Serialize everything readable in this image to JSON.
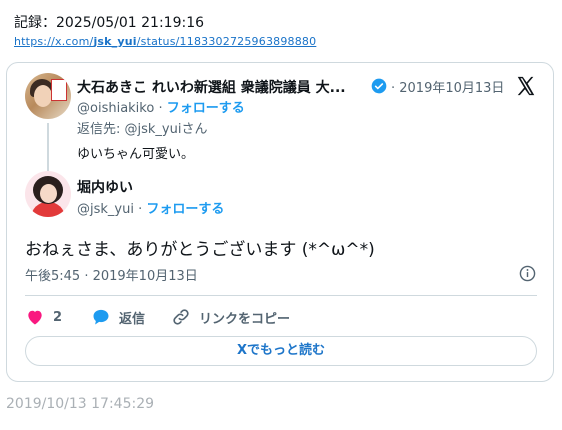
{
  "header": {
    "record": "記録：2025/05/01 21:19:16",
    "url_prefix": "https://x.com/",
    "url_user": "jsk_yui",
    "url_suffix": "/status/1183302725963898880"
  },
  "quoted_tweet": {
    "author_name": "大石あきこ れいわ新選組 衆議院議員 大...",
    "date": "· 2019年10月13日",
    "handle": "@oishiakiko",
    "separator": " · ",
    "follow_label": "フォローする",
    "reply_to": "返信先: @jsk_yuiさん",
    "text": "ゆいちゃん可愛い。"
  },
  "main_tweet": {
    "author_name": "堀内ゆい",
    "handle": "@jsk_yui",
    "separator": " · ",
    "follow_label": "フォローする",
    "text": "おねぇさま、ありがとうございます (*^ω^*)",
    "timestamp": "午後5:45 · 2019年10月13日"
  },
  "actions": {
    "like_count": "2",
    "reply_label": "返信",
    "copy_link_label": "リンクをコピー",
    "read_more_label": "Xでもっと読む"
  },
  "footer": {
    "archived_time": "2019/10/13 17:45:29"
  },
  "colors": {
    "like": "#f91880",
    "reply": "#1d9bf0",
    "link": "#1d9bf0",
    "verified": "#1d9bf0"
  },
  "icons": [
    "heart-icon",
    "reply-bubble-icon",
    "link-icon",
    "info-icon",
    "x-logo-icon",
    "verified-badge-icon"
  ]
}
